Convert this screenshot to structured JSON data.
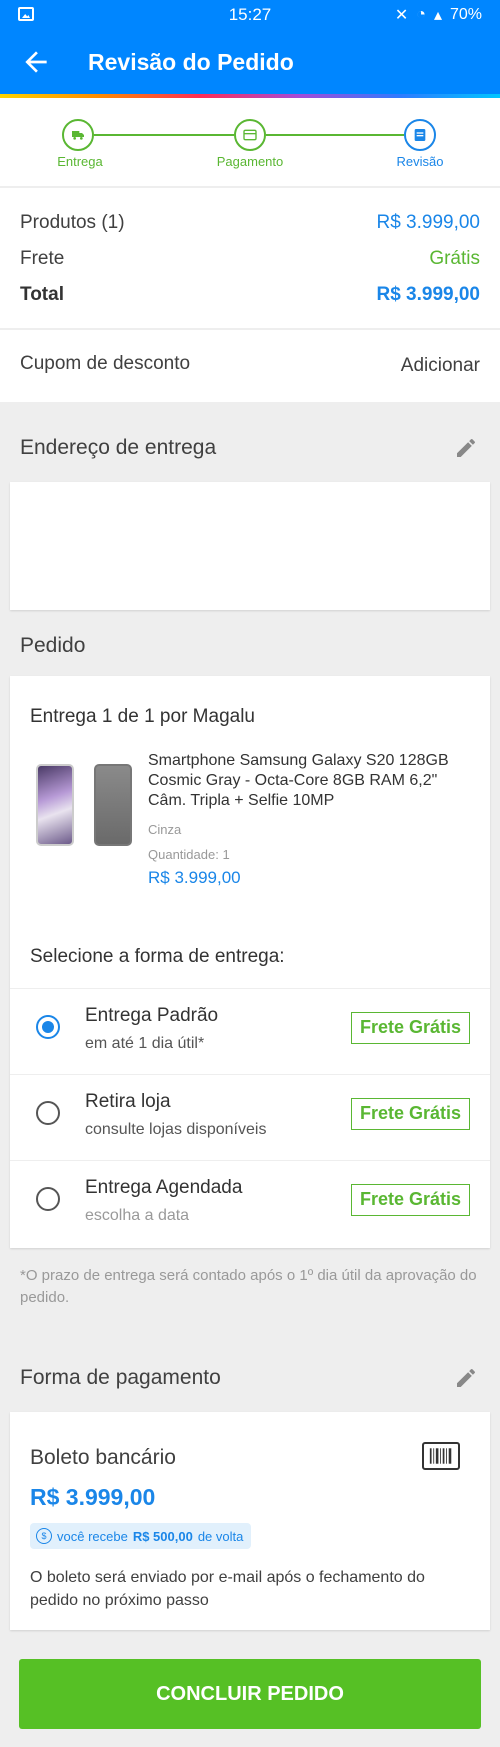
{
  "status_bar": {
    "time": "15:27",
    "battery": "70%"
  },
  "appbar": {
    "title": "Revisão do Pedido"
  },
  "steps": [
    {
      "label": "Entrega",
      "icon": "truck-icon"
    },
    {
      "label": "Pagamento",
      "icon": "card-icon"
    },
    {
      "label": "Revisão",
      "icon": "list-icon"
    }
  ],
  "summary": {
    "products_label": "Produtos (1)",
    "products_value": "R$ 3.999,00",
    "shipping_label": "Frete",
    "shipping_value": "Grátis",
    "total_label": "Total",
    "total_value": "R$ 3.999,00"
  },
  "coupon": {
    "label": "Cupom de desconto",
    "action": "Adicionar"
  },
  "address": {
    "title": "Endereço de entrega"
  },
  "order": {
    "title": "Pedido",
    "delivery_title": "Entrega 1 de 1 por Magalu",
    "product": {
      "name": "Smartphone Samsung Galaxy S20 128GB Cosmic Gray - Octa-Core 8GB RAM 6,2\" Câm. Tripla + Selfie 10MP",
      "color": "Cinza",
      "quantity": "Quantidade:  1",
      "price": "R$ 3.999,00"
    },
    "select_title": "Selecione a forma de entrega:",
    "options": [
      {
        "title": "Entrega Padrão",
        "subtitle": "em até 1 dia útil*",
        "badge": "Frete Grátis",
        "selected": true
      },
      {
        "title": "Retira loja",
        "subtitle": "consulte lojas disponíveis",
        "badge": "Frete Grátis",
        "selected": false
      },
      {
        "title": "Entrega Agendada",
        "subtitle": "escolha a data",
        "badge": "Frete Grátis",
        "selected": false
      }
    ]
  },
  "note": "*O prazo de entrega será contado após o 1º dia útil da aprovação do pedido.",
  "payment": {
    "title": "Forma de pagamento",
    "method": "Boleto bancário",
    "price": "R$ 3.999,00",
    "cashback_prefix": "você recebe",
    "cashback_value": "R$ 500,00",
    "cashback_suffix": "de volta",
    "description": "O boleto será enviado por e-mail após o fechamento do pedido no próximo passo"
  },
  "cta": {
    "label": "CONCLUIR PEDIDO"
  },
  "colors": {
    "primary": "#0086ff",
    "blue_text": "#1a86e8",
    "green": "#5ab733",
    "cta": "#56c025"
  }
}
